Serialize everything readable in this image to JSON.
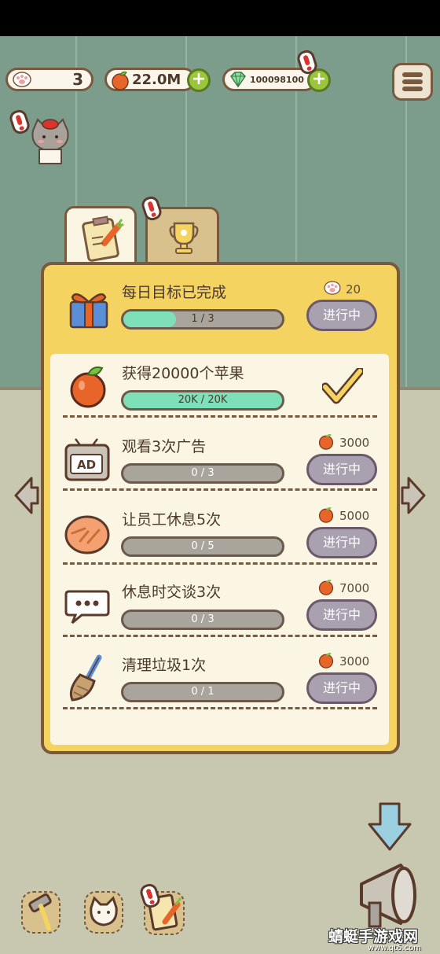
{
  "status_bar": {
    "paw_count": "3",
    "apples": "22.0M",
    "gems": "100098100"
  },
  "tabs": [
    {
      "name": "clipboard-carrot-tab",
      "active": true
    },
    {
      "name": "trophy-tab",
      "active": false
    }
  ],
  "daily_goal": {
    "title": "每日目标已完成",
    "reward": "20",
    "progress_text": "1 / 3",
    "progress": 0.333,
    "button": "进行中"
  },
  "tasks": [
    {
      "title": "获得20000个苹果",
      "progress_text": "20K / 20K",
      "progress": 1.0,
      "reward": "",
      "button": "",
      "completed": true,
      "icon": "apple-icon"
    },
    {
      "title": "观看3次广告",
      "progress_text": "0 / 3",
      "progress": 0,
      "reward": "3000",
      "button": "进行中",
      "completed": false,
      "icon": "tv-ad-icon"
    },
    {
      "title": "让员工休息5次",
      "progress_text": "0 / 5",
      "progress": 0,
      "reward": "5000",
      "button": "进行中",
      "completed": false,
      "icon": "bread-icon"
    },
    {
      "title": "休息时交谈3次",
      "progress_text": "0 / 3",
      "progress": 0,
      "reward": "7000",
      "button": "进行中",
      "completed": false,
      "icon": "speech-bubble-icon"
    },
    {
      "title": "清理垃圾1次",
      "progress_text": "0 / 1",
      "progress": 0,
      "reward": "3000",
      "button": "进行中",
      "completed": false,
      "icon": "broom-icon"
    }
  ],
  "watermark": {
    "text": "蜻蜓手游戏网",
    "url": "www.qt6.com"
  },
  "colors": {
    "panel": "#f5d360",
    "progress_fill": "#7de0b8",
    "button": "#a9a0b0",
    "wall": "#7c9c8c"
  }
}
